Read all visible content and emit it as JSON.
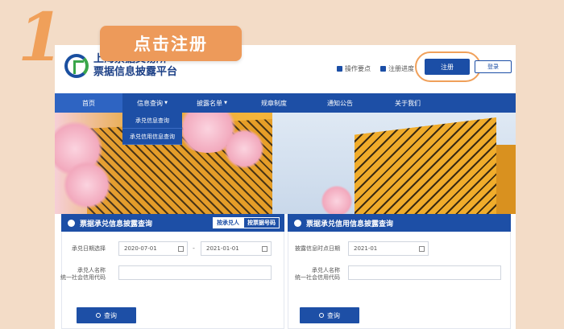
{
  "step": {
    "number": "1",
    "banner": "点击注册"
  },
  "site": {
    "title": "上海票据交易所",
    "title2": "票据信息披露平台"
  },
  "header": {
    "guide": "操作要点",
    "progress": "注册进度",
    "register": "注册",
    "login": "登录"
  },
  "nav": {
    "items": [
      "首页",
      "信息查询",
      "披露名单",
      "规章制度",
      "通知公告",
      "关于我们"
    ],
    "dropdown": [
      "承兑信息查询",
      "承兑信用信息查询"
    ]
  },
  "left_panel": {
    "title": "票据承兑信息披露查询",
    "tabs": [
      "按承兑人",
      "按票据号码"
    ],
    "date_label": "承兑日期选择",
    "date_from": "2020-07-01",
    "date_to": "2021-01-01",
    "dash": "-",
    "name_label": "承兑人名称",
    "code_label": "统一社会信用代码",
    "query": "查询"
  },
  "right_panel": {
    "title": "票据承兑信用信息披露查询",
    "date_label": "披露信息时点日期",
    "date": "2021-01",
    "name_label": "承兑人名称",
    "code_label": "统一社会信用代码",
    "query": "查询"
  },
  "colors": {
    "brand": "#1d4fa6",
    "accent": "#ed9a5a"
  }
}
